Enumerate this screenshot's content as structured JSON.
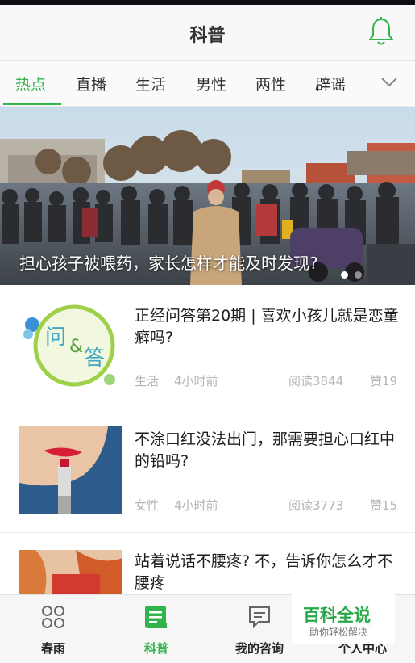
{
  "header": {
    "title": "科普",
    "bell_icon": "bell-icon"
  },
  "tabs": [
    {
      "label": "热点",
      "active": true
    },
    {
      "label": "直播"
    },
    {
      "label": "生活"
    },
    {
      "label": "男性"
    },
    {
      "label": "两性"
    },
    {
      "label": "辟谣"
    }
  ],
  "banner": {
    "caption": "担心孩子被喂药，家长怎样才能及时发现?",
    "slides": 2,
    "active_slide": 1
  },
  "articles": [
    {
      "title": "正经问答第20期 | 喜欢小孩儿就是恋童癖吗?",
      "category": "生活",
      "time": "4小时前",
      "reads": "阅读3844",
      "likes": "赞19",
      "thumb": {
        "text1": "问",
        "text2": "&",
        "text3": "答"
      }
    },
    {
      "title": "不涂口红没法出门，那需要担心口红中的铅吗?",
      "category": "女性",
      "time": "4小时前",
      "reads": "阅读3773",
      "likes": "赞15"
    },
    {
      "title": "站着说话不腰疼? 不，告诉你怎么才不腰疼"
    }
  ],
  "bottom_nav": [
    {
      "label": "春雨",
      "icon": "clover-icon"
    },
    {
      "label": "科普",
      "icon": "article-icon",
      "active": true
    },
    {
      "label": "我的咨询",
      "icon": "chat-icon"
    },
    {
      "label": "个人中心",
      "icon": "person-icon"
    }
  ],
  "watermark": {
    "main": "百科全说",
    "sub": "助你轻松解决"
  },
  "colors": {
    "accent": "#2fb34a",
    "meta": "#b5b5b5"
  }
}
